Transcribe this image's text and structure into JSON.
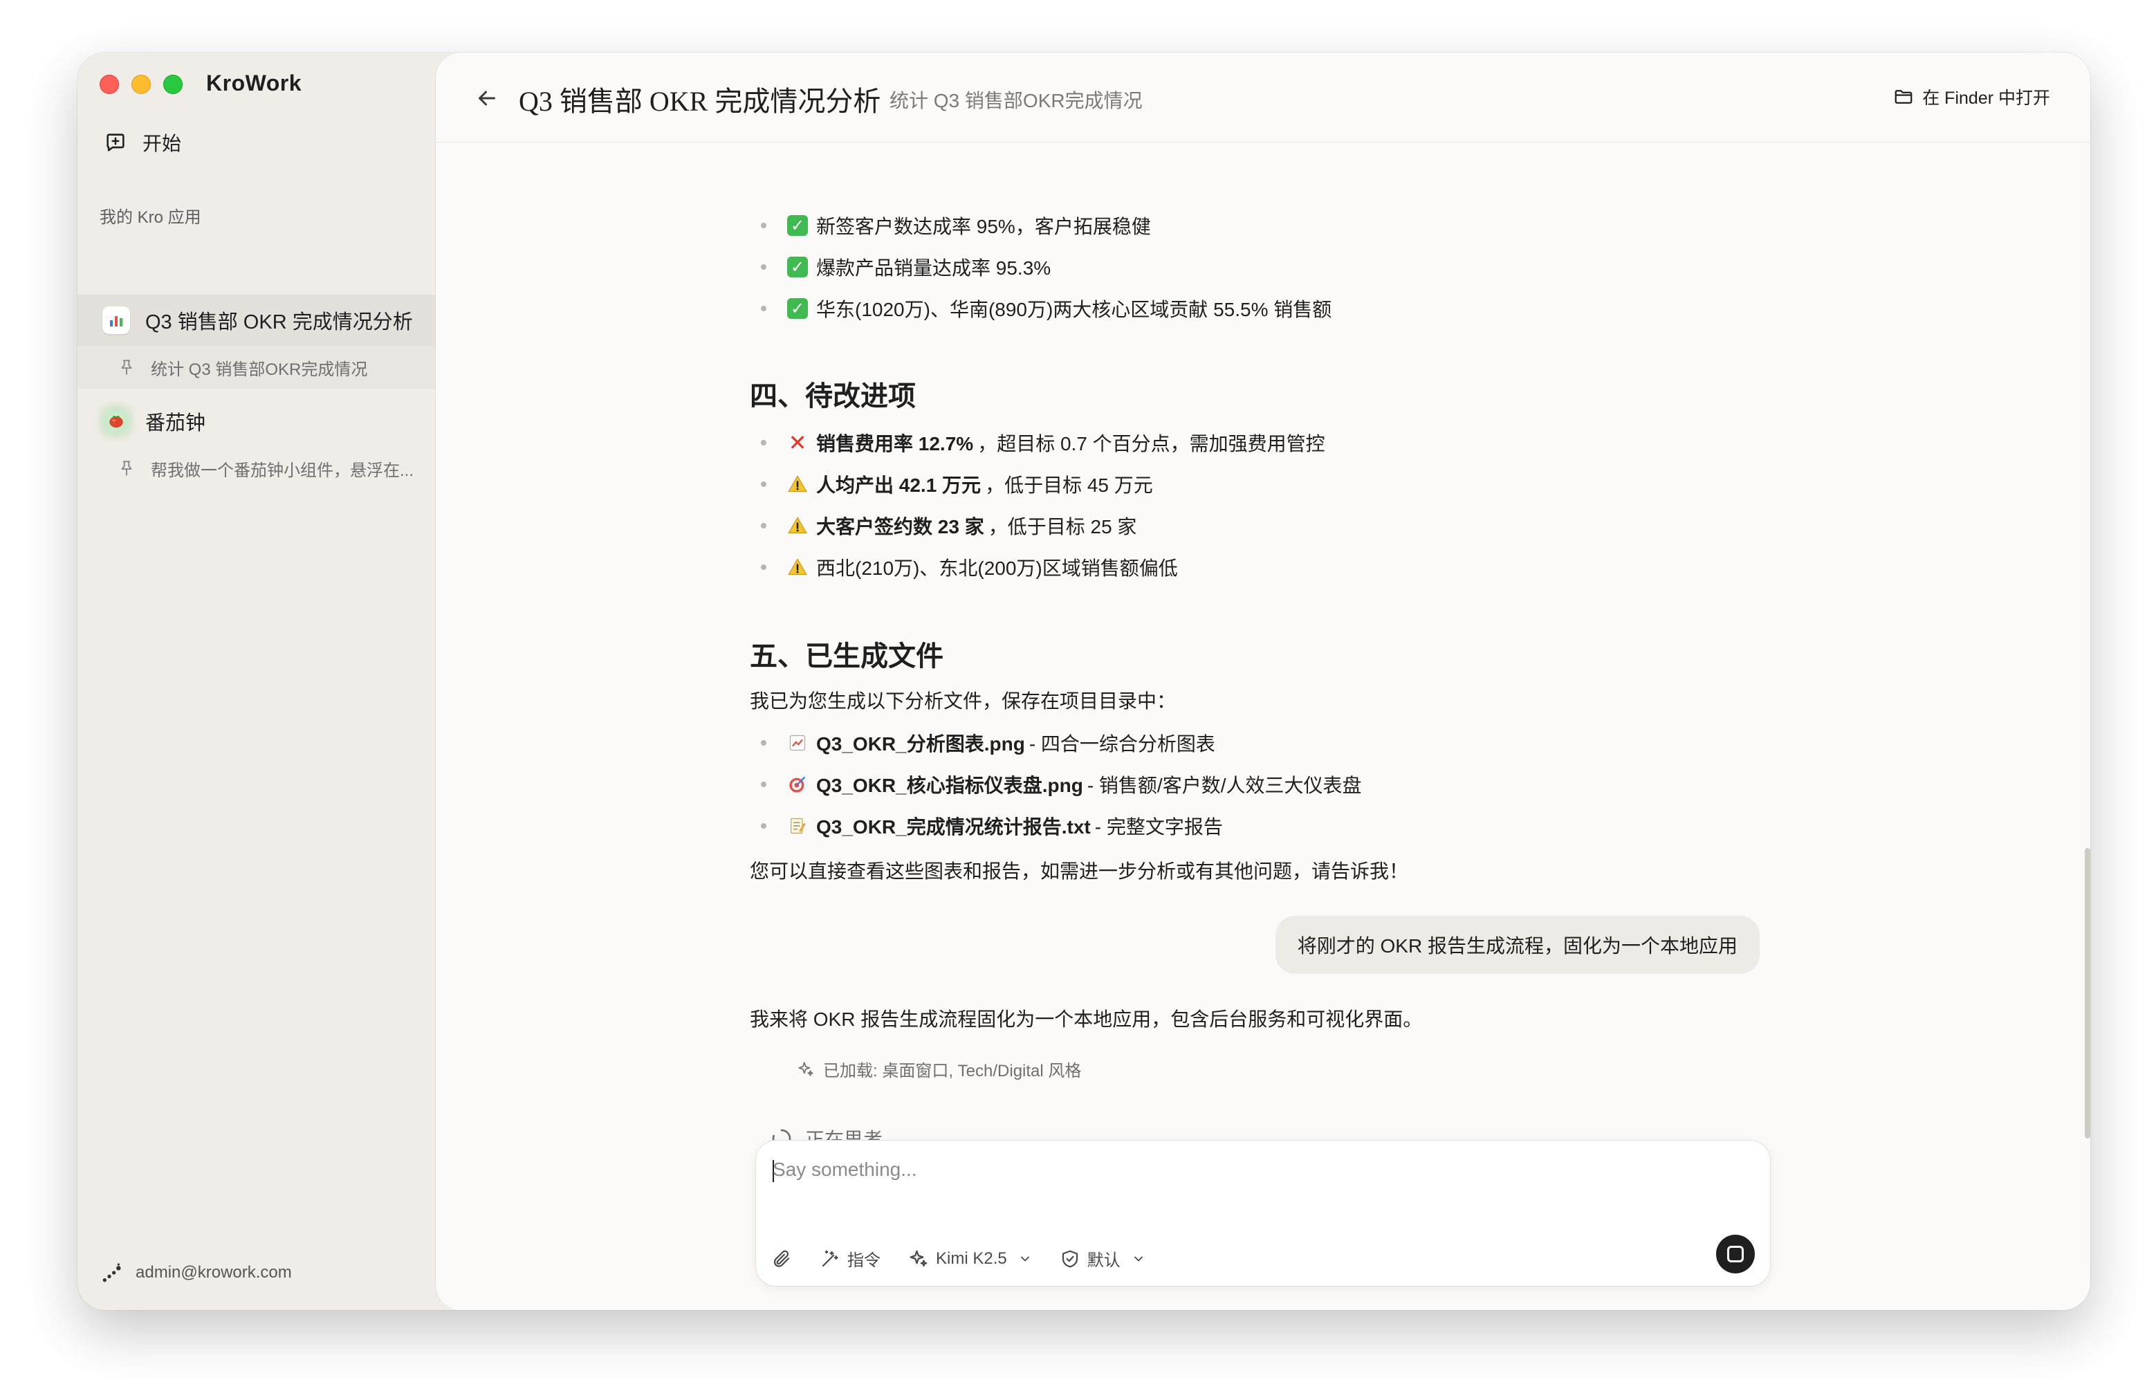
{
  "app": {
    "title": "KroWork"
  },
  "sidebar": {
    "start_label": "开始",
    "section_label": "我的 Kro 应用",
    "items": [
      {
        "label": "Q3 销售部 OKR 完成情况分析",
        "icon": "bar-chart-icon",
        "sub": "统计 Q3 销售部OKR完成情况"
      },
      {
        "label": "番茄钟",
        "icon": "tomato-icon",
        "sub": "帮我做一个番茄钟小组件，悬浮在..."
      }
    ],
    "user_email": "admin@krowork.com"
  },
  "header": {
    "title": "Q3 销售部 OKR 完成情况分析",
    "subtitle": "统计 Q3 销售部OKR完成情况",
    "finder_label": "在 Finder 中打开"
  },
  "chat": {
    "achievements": [
      {
        "icon": "check-icon",
        "text": "新签客户数达成率 95%，客户拓展稳健"
      },
      {
        "icon": "check-icon",
        "text": "爆款产品销量达成率 95.3%"
      },
      {
        "icon": "check-icon",
        "text": "华东(1020万)、华南(890万)两大核心区域贡献 55.5% 销售额"
      }
    ],
    "section4_title": "四、待改进项",
    "improvements": [
      {
        "icon": "cross-icon",
        "bold": "销售费用率 12.7%",
        "rest": "，超目标 0.7 个百分点，需加强费用管控"
      },
      {
        "icon": "warning-icon",
        "bold": "人均产出 42.1 万元",
        "rest": "，低于目标 45 万元"
      },
      {
        "icon": "warning-icon",
        "bold": "大客户签约数 23 家",
        "rest": "，低于目标 25 家"
      },
      {
        "icon": "warning-icon",
        "bold": "",
        "rest": "西北(210万)、东北(200万)区域销售额偏低"
      }
    ],
    "section5_title": "五、已生成文件",
    "files_intro": "我已为您生成以下分析文件，保存在项目目录中：",
    "files": [
      {
        "icon": "chart-icon",
        "bold": "Q3_OKR_分析图表.png",
        "rest": " - 四合一综合分析图表"
      },
      {
        "icon": "target-icon",
        "bold": "Q3_OKR_核心指标仪表盘.png",
        "rest": " - 销售额/客户数/人效三大仪表盘"
      },
      {
        "icon": "memo-icon",
        "bold": "Q3_OKR_完成情况统计报告.txt",
        "rest": " - 完整文字报告"
      }
    ],
    "closing": "您可以直接查看这些图表和报告，如需进一步分析或有其他问题，请告诉我！",
    "user_message": "将刚才的 OKR 报告生成流程，固化为一个本地应用",
    "assistant_reply": "我来将 OKR 报告生成流程固化为一个本地应用，包含后台服务和可视化界面。",
    "loaded_text": "已加载: 桌面窗口, Tech/Digital 风格",
    "thinking_text": "正在思考..."
  },
  "composer": {
    "placeholder": "Say something...",
    "command_label": "指令",
    "model_label": "Kimi K2.5",
    "mode_label": "默认"
  }
}
